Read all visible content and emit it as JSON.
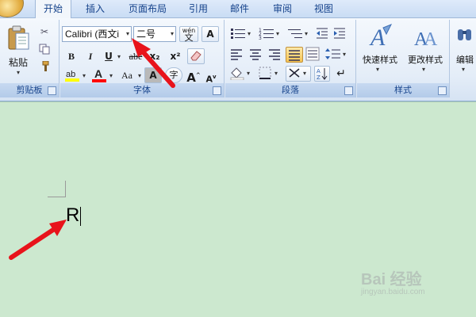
{
  "tabs": [
    "开始",
    "插入",
    "页面布局",
    "引用",
    "邮件",
    "审阅",
    "视图"
  ],
  "clipboard": {
    "paste_label": "粘贴",
    "group_label": "剪贴板"
  },
  "font": {
    "font_name": "Calibri (西文i",
    "font_size": "二号",
    "bold": "B",
    "italic": "I",
    "underline": "U",
    "subscript": "x₂",
    "superscript": "x²",
    "case": "Aa",
    "char_shade": "A",
    "grow": "A",
    "shrink": "A",
    "encircle": "字",
    "phonetic": "wén",
    "group_label": "字体"
  },
  "paragraph": {
    "group_label": "段落"
  },
  "styles": {
    "quick_styles": "快速样式",
    "change_styles": "更改样式",
    "group_label": "样式"
  },
  "editing": {
    "label": "编辑"
  },
  "document": {
    "text": "R"
  },
  "watermark": {
    "brand": "Bai 经验",
    "url": "jingyan.baidu.com"
  },
  "colors": {
    "accent": "#15428b",
    "highlight": "#ffff00",
    "font_color": "#ff0000",
    "annotation": "#e8131b",
    "page": "#cce8cf"
  }
}
